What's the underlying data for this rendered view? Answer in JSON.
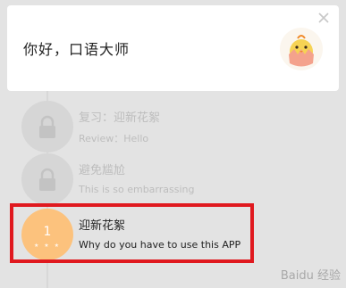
{
  "header": {
    "greeting": "你好，口语大师"
  },
  "lessons": [
    {
      "title": "复习：迎新花絮",
      "subtitle": "Review：Hello",
      "state": "locked"
    },
    {
      "title": "避免尴尬",
      "subtitle": "This is so embarrassing",
      "state": "locked"
    },
    {
      "number": "1",
      "stars": "★ ★ ★",
      "title": "迎新花絮",
      "subtitle": "Why do you have to use this APP",
      "state": "active"
    }
  ],
  "watermark": "Baidu 经验",
  "colors": {
    "background": "#e3e3e3",
    "card": "#ffffff",
    "active_circle": "#fcc27d",
    "locked_circle": "#d6d6d6",
    "highlight": "#e0191f"
  },
  "icons": {
    "close": "close-icon",
    "mascot": "mascot-icon",
    "lock": "lock-icon"
  }
}
